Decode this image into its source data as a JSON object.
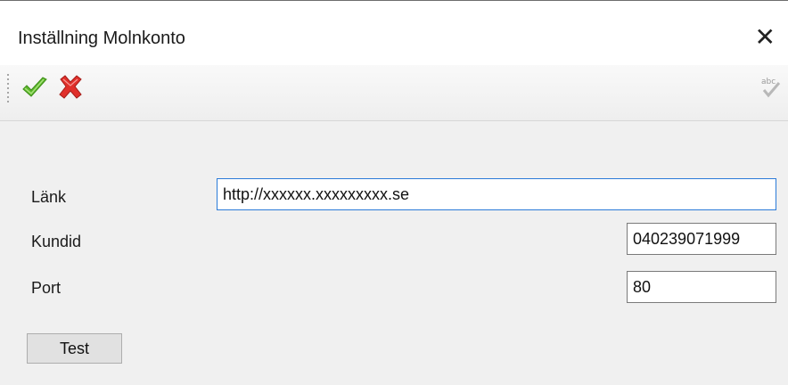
{
  "window": {
    "title": "Inställning Molnkonto",
    "close_glyph": "✕"
  },
  "toolbar": {
    "ok_icon": "green-checkmark-icon",
    "cancel_icon": "red-x-icon",
    "spell_icon": "spellcheck-icon",
    "colors": {
      "ok": "#5cb82a",
      "cancel": "#e0302b"
    }
  },
  "form": {
    "link": {
      "label": "Länk",
      "value": "http://xxxxxx.xxxxxxxxx.se"
    },
    "customer_id": {
      "label": "Kundid",
      "value": "040239071999"
    },
    "port": {
      "label": "Port",
      "value": "80"
    },
    "test_button": "Test"
  }
}
